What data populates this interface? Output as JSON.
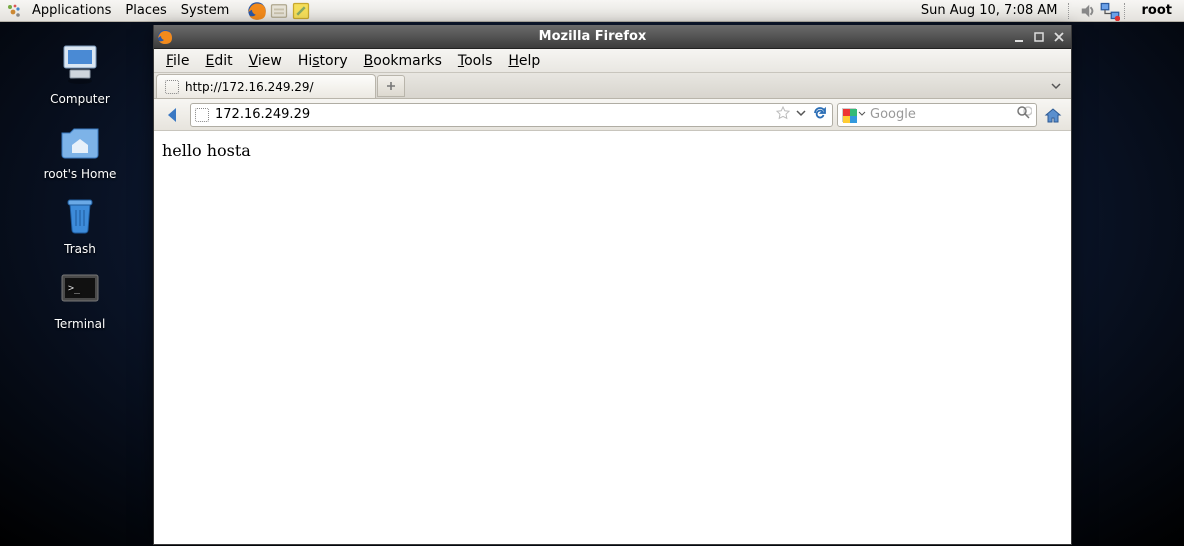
{
  "panel": {
    "menus": [
      "Applications",
      "Places",
      "System"
    ],
    "clock": "Sun Aug 10,  7:08 AM",
    "user": "root"
  },
  "desktop": {
    "icons": [
      {
        "name": "computer",
        "label": "Computer"
      },
      {
        "name": "home",
        "label": "root's Home"
      },
      {
        "name": "trash",
        "label": "Trash"
      },
      {
        "name": "terminal",
        "label": "Terminal"
      }
    ]
  },
  "window": {
    "title": "Mozilla Firefox",
    "menubar": [
      "File",
      "Edit",
      "View",
      "History",
      "Bookmarks",
      "Tools",
      "Help"
    ],
    "tab_label": "http://172.16.249.29/",
    "url": "172.16.249.29",
    "search_placeholder": "Google",
    "page_body": "hello hosta"
  }
}
